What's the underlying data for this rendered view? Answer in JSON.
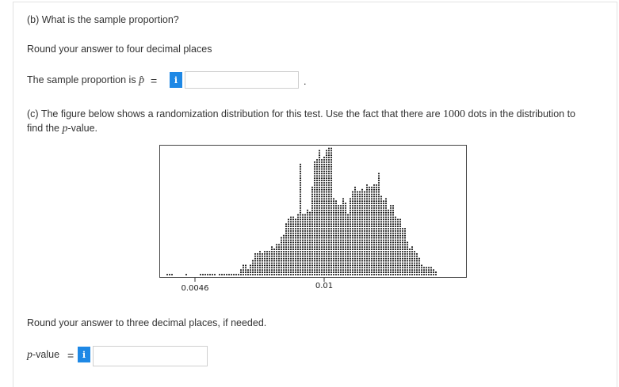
{
  "question_b": {
    "label": "(b) What is the sample proportion?",
    "instruction": "Round your answer to four decimal places",
    "answer_prefix": "The sample proportion is",
    "phat_symbol": "p̂",
    "equals": "=",
    "info_icon": "i",
    "answer_value": "",
    "answer_suffix": "."
  },
  "question_c": {
    "line1_before": "(c) The figure below shows a randomization distribution for this test. Use the fact that there are ",
    "dots_count": "1000",
    "line1_after": " dots in the distribution to",
    "line2_before": "find the ",
    "p_symbol": "p",
    "line2_after": "-value.",
    "instruction": "Round your answer to three decimal places, if needed.",
    "pvalue_label_p": "p",
    "pvalue_label_rest": "-value",
    "equals": "=",
    "info_icon": "i",
    "answer_value": ""
  },
  "chart_data": {
    "type": "scatter",
    "tick_labels": [
      "0.0046",
      "0.01"
    ],
    "tick_values": [
      0.0046,
      0.01
    ],
    "total_dots": 1000,
    "dot_color": "#111111"
  },
  "colors": {
    "accent": "#1e88e5",
    "border": "#cfcfcf"
  }
}
